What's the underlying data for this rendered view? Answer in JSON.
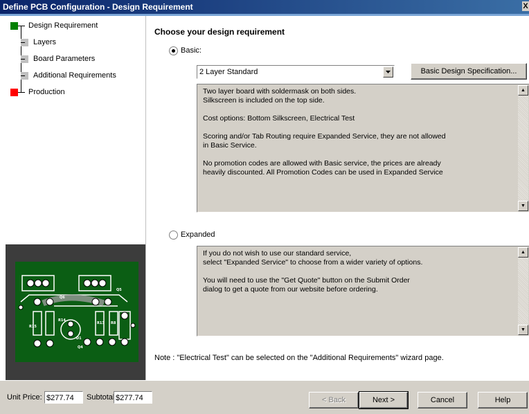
{
  "window": {
    "title": "Define PCB Configuration - Design Requirement",
    "close_glyph": "X"
  },
  "steps": [
    {
      "label": "Design Requirement",
      "color": "#008000"
    },
    {
      "label": "Layers",
      "color": "#c0c0c0"
    },
    {
      "label": "Board Parameters",
      "color": "#c0c0c0"
    },
    {
      "label": "Additional Requirements",
      "color": "#c0c0c0"
    },
    {
      "label": "Production",
      "color": "#ff0000"
    }
  ],
  "pcb_preview": {
    "labels": [
      "Q6",
      "Q5",
      "R15",
      "R13",
      "R14",
      "D1",
      "R8",
      "Q4"
    ]
  },
  "main": {
    "heading": "Choose your design requirement",
    "basic": {
      "label": "Basic:",
      "selected": true,
      "dropdown_value": "2 Layer Standard",
      "spec_button": "Basic Design Specification...",
      "description": "Two layer board with soldermask on both sides.\nSilkscreen is included on the top side.\n\nCost options:  Bottom Silkscreen,  Electrical Test\n\nScoring and/or Tab Routing require Expanded Service, they are not allowed\nin Basic Service.\n\nNo promotion codes are allowed with Basic service, the prices are already\nheavily discounted.  All Promotion Codes can be used in Expanded Service"
    },
    "expanded": {
      "label": "Expanded",
      "selected": false,
      "description": "If you do not wish to use our standard service,\nselect  \"Expanded Service\" to choose from a wider variety of options.\n\nYou will need to use the \"Get Quote\" button on the Submit Order\ndialog to get a quote from our website before ordering."
    },
    "note": "Note : \"Electrical Test\" can be selected on the \"Additional Requirements\" wizard page."
  },
  "footer": {
    "unit_price_label": "Unit Price:",
    "unit_price": "$277.74",
    "subtotal_label": "Subtotal:",
    "subtotal": "$277.74",
    "back": "< Back",
    "next": "Next >",
    "cancel": "Cancel",
    "help": "Help"
  },
  "icons": {
    "dropdown": "chevron-down-icon",
    "scroll_up": "scroll-up-icon",
    "scroll_down": "scroll-down-icon"
  }
}
